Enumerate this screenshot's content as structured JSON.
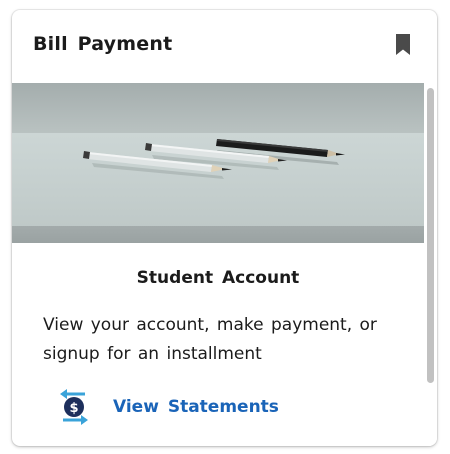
{
  "card": {
    "title": "Bill Payment",
    "bookmark_icon": "bookmark-icon"
  },
  "hero": {
    "image": "pencils-on-table-image"
  },
  "content": {
    "section_title": "Student Account",
    "description": "View your account, make payment, or signup for an installment"
  },
  "action": {
    "icon": "dollar-exchange-icon",
    "label": "View Statements"
  },
  "colors": {
    "link": "#1a64b8",
    "icon_navy": "#1d2f5c",
    "icon_arrows": "#3aa3d9",
    "bookmark": "#4a4a4a"
  }
}
